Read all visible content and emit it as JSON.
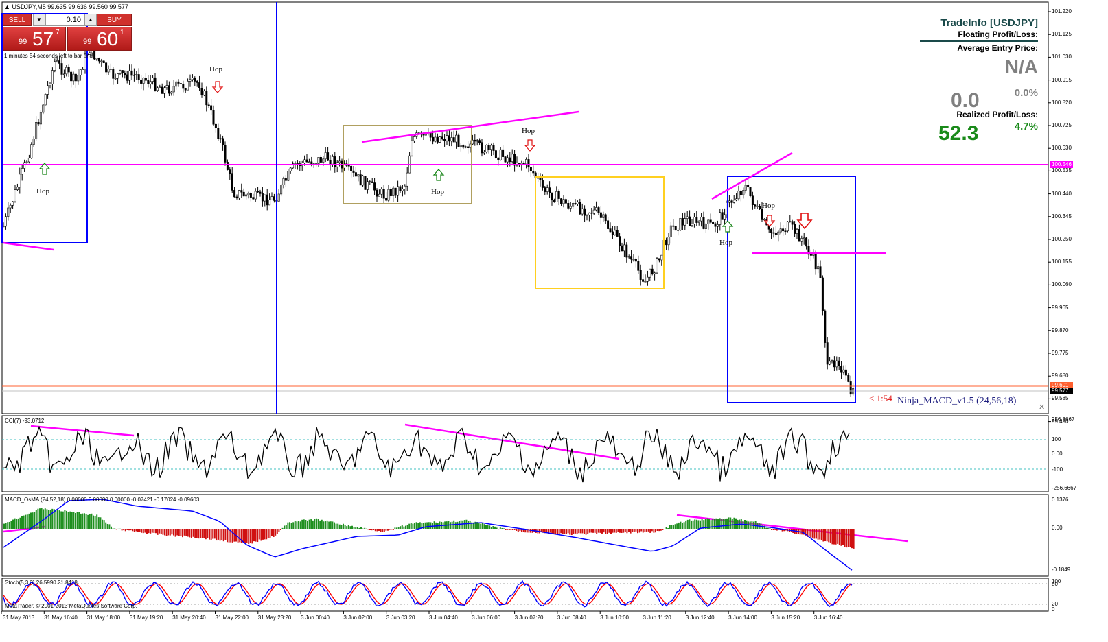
{
  "window": {
    "symbol_header": "USDJPY,M5  99.635 99.636 99.560 99.577",
    "countdown_text": "1 minutes 54 seconds left to bar end",
    "copyright": "MetaTrader, © 2001-2013 MetaQuotes Software Corp."
  },
  "trade_panel": {
    "sell_label": "SELL",
    "buy_label": "BUY",
    "dec_icon": "▼",
    "inc_icon": "▲",
    "lot_value": "0.10",
    "sell_price": {
      "prefix": "99",
      "big": "57",
      "sup": "7"
    },
    "buy_price": {
      "prefix": "99",
      "big": "60",
      "sup": "1"
    }
  },
  "tradeinfo": {
    "title": "TradeInfo [USDJPY]",
    "floating_label": "Floating Profit/Loss:",
    "avg_label": "Average Entry Price:",
    "avg_value": "N/A",
    "floating_value": "0.0",
    "floating_pct": "0.0%",
    "realized_label": "Realized Profit/Loss:",
    "realized_value": "52.3",
    "realized_pct": "4.7%"
  },
  "price_axis": {
    "ticks": [
      "101.220",
      "101.125",
      "101.030",
      "100.915",
      "100.820",
      "100.725",
      "100.630",
      "100.535",
      "100.440",
      "100.345",
      "100.250",
      "100.155",
      "100.060",
      "99.965",
      "99.870",
      "99.775",
      "99.680",
      "99.585",
      "99.490"
    ],
    "tag_level": "100.546",
    "tag_bid": "99.577",
    "tag_order": "99.601"
  },
  "annotations": {
    "hop": "Hop",
    "timer": "< 1:54",
    "indicator_name": "Ninja_MACD_v1.5 (24,56,18)"
  },
  "cci": {
    "label": "CCI(7) -93.0712",
    "ticks": [
      "256.6667",
      "100",
      "0.00",
      "-100",
      "-256.6667"
    ]
  },
  "macd": {
    "label": "MACD_OsMA (24,52,18) 0.00000 0.00000 0.00000 -0.07421 -0.17024 -0.09603",
    "ticks": [
      "0.1376",
      "0.00",
      "-0.1849"
    ]
  },
  "stoch": {
    "label": "Stoch(5,3,3) 26.5990 21.8418",
    "ticks": [
      "100",
      "80",
      "20",
      "0"
    ]
  },
  "time_axis": [
    "31 May 2013",
    "31 May 16:40",
    "31 May 18:00",
    "31 May 19:20",
    "31 May 20:40",
    "31 May 22:00",
    "31 May 23:20",
    "3 Jun 00:40",
    "3 Jun 02:00",
    "3 Jun 03:20",
    "3 Jun 04:40",
    "3 Jun 06:00",
    "3 Jun 07:20",
    "3 Jun 08:40",
    "3 Jun 10:00",
    "3 Jun 11:20",
    "3 Jun 12:40",
    "3 Jun 14:00",
    "3 Jun 15:20",
    "3 Jun 16:40"
  ],
  "colors": {
    "level_line": "#ff00ff",
    "vertical_line": "#0000ff",
    "bull_hist": "#1f8f1f",
    "bear_hist": "#d01010",
    "macd_line": "#0000ff",
    "stoch_main": "#0000ff",
    "stoch_signal": "#ff0000"
  }
}
